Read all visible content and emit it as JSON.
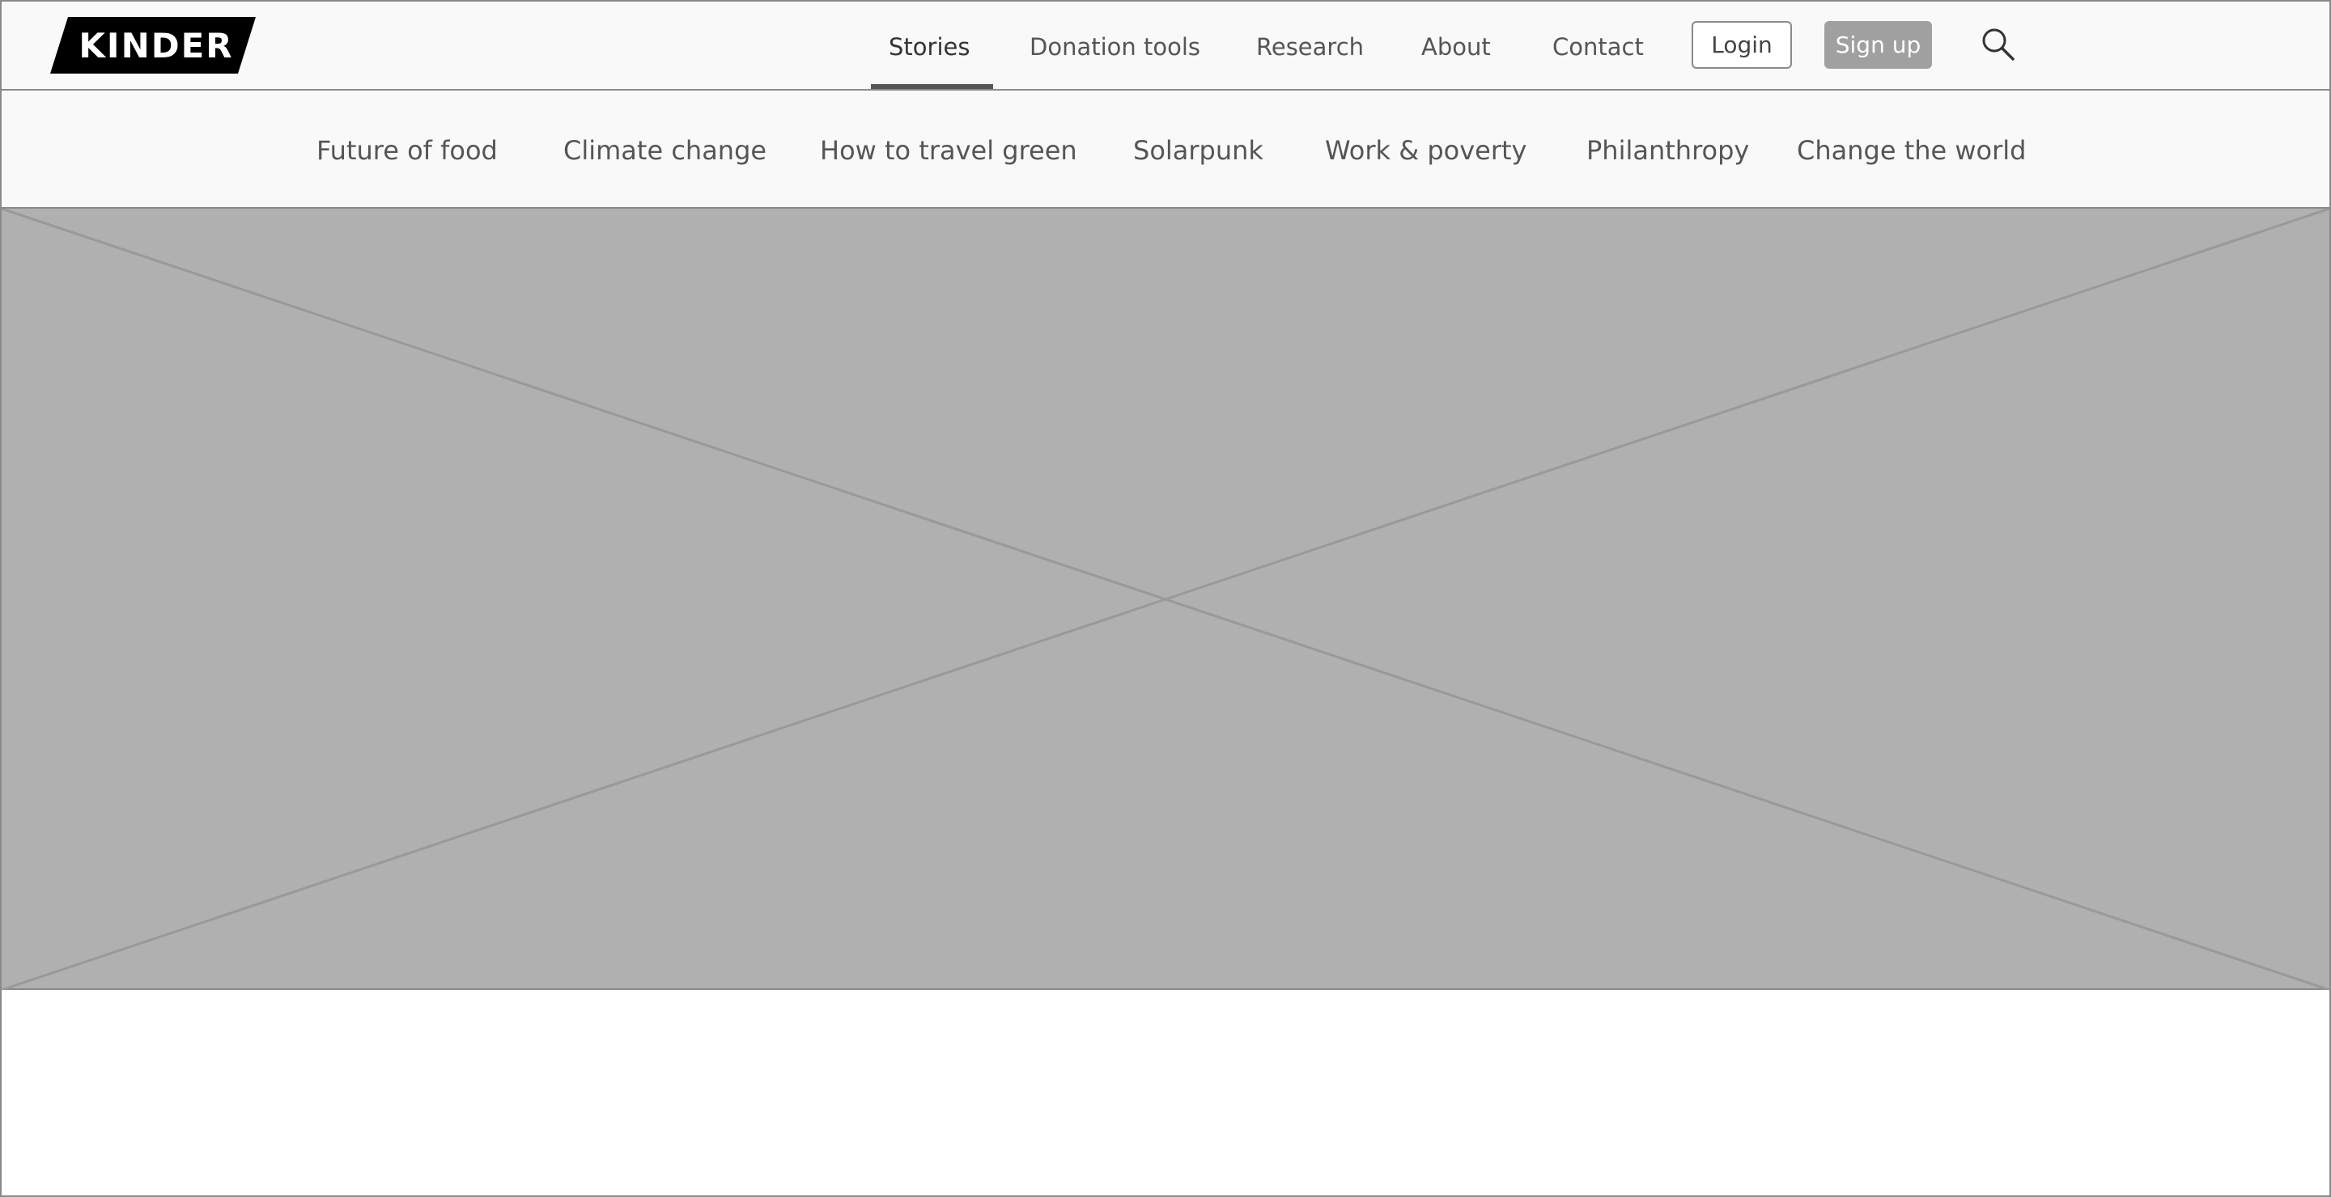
{
  "brand": {
    "logo_text": "KINDER",
    "logo_color": "#000000"
  },
  "main_nav": {
    "items": [
      {
        "label": "Stories",
        "active": true
      },
      {
        "label": "Donation tools",
        "active": false
      },
      {
        "label": "Research",
        "active": false
      },
      {
        "label": "About",
        "active": false
      },
      {
        "label": "Contact",
        "active": false
      }
    ]
  },
  "auth": {
    "login_label": "Login",
    "signup_label": "Sign up"
  },
  "search": {
    "icon": "search-icon"
  },
  "categories": {
    "items": [
      {
        "label": "Future of food"
      },
      {
        "label": "Climate change"
      },
      {
        "label": "How to travel green"
      },
      {
        "label": "Solarpunk"
      },
      {
        "label": "Work & poverty"
      },
      {
        "label": "Philanthropy"
      },
      {
        "label": "Change the world"
      }
    ]
  },
  "colors": {
    "header_bg": "#f9f9f9",
    "border": "#8a8a8a",
    "placeholder_fill": "#b0b0b0",
    "signup_bg": "#a0a0a0",
    "active_underline": "#555555"
  }
}
